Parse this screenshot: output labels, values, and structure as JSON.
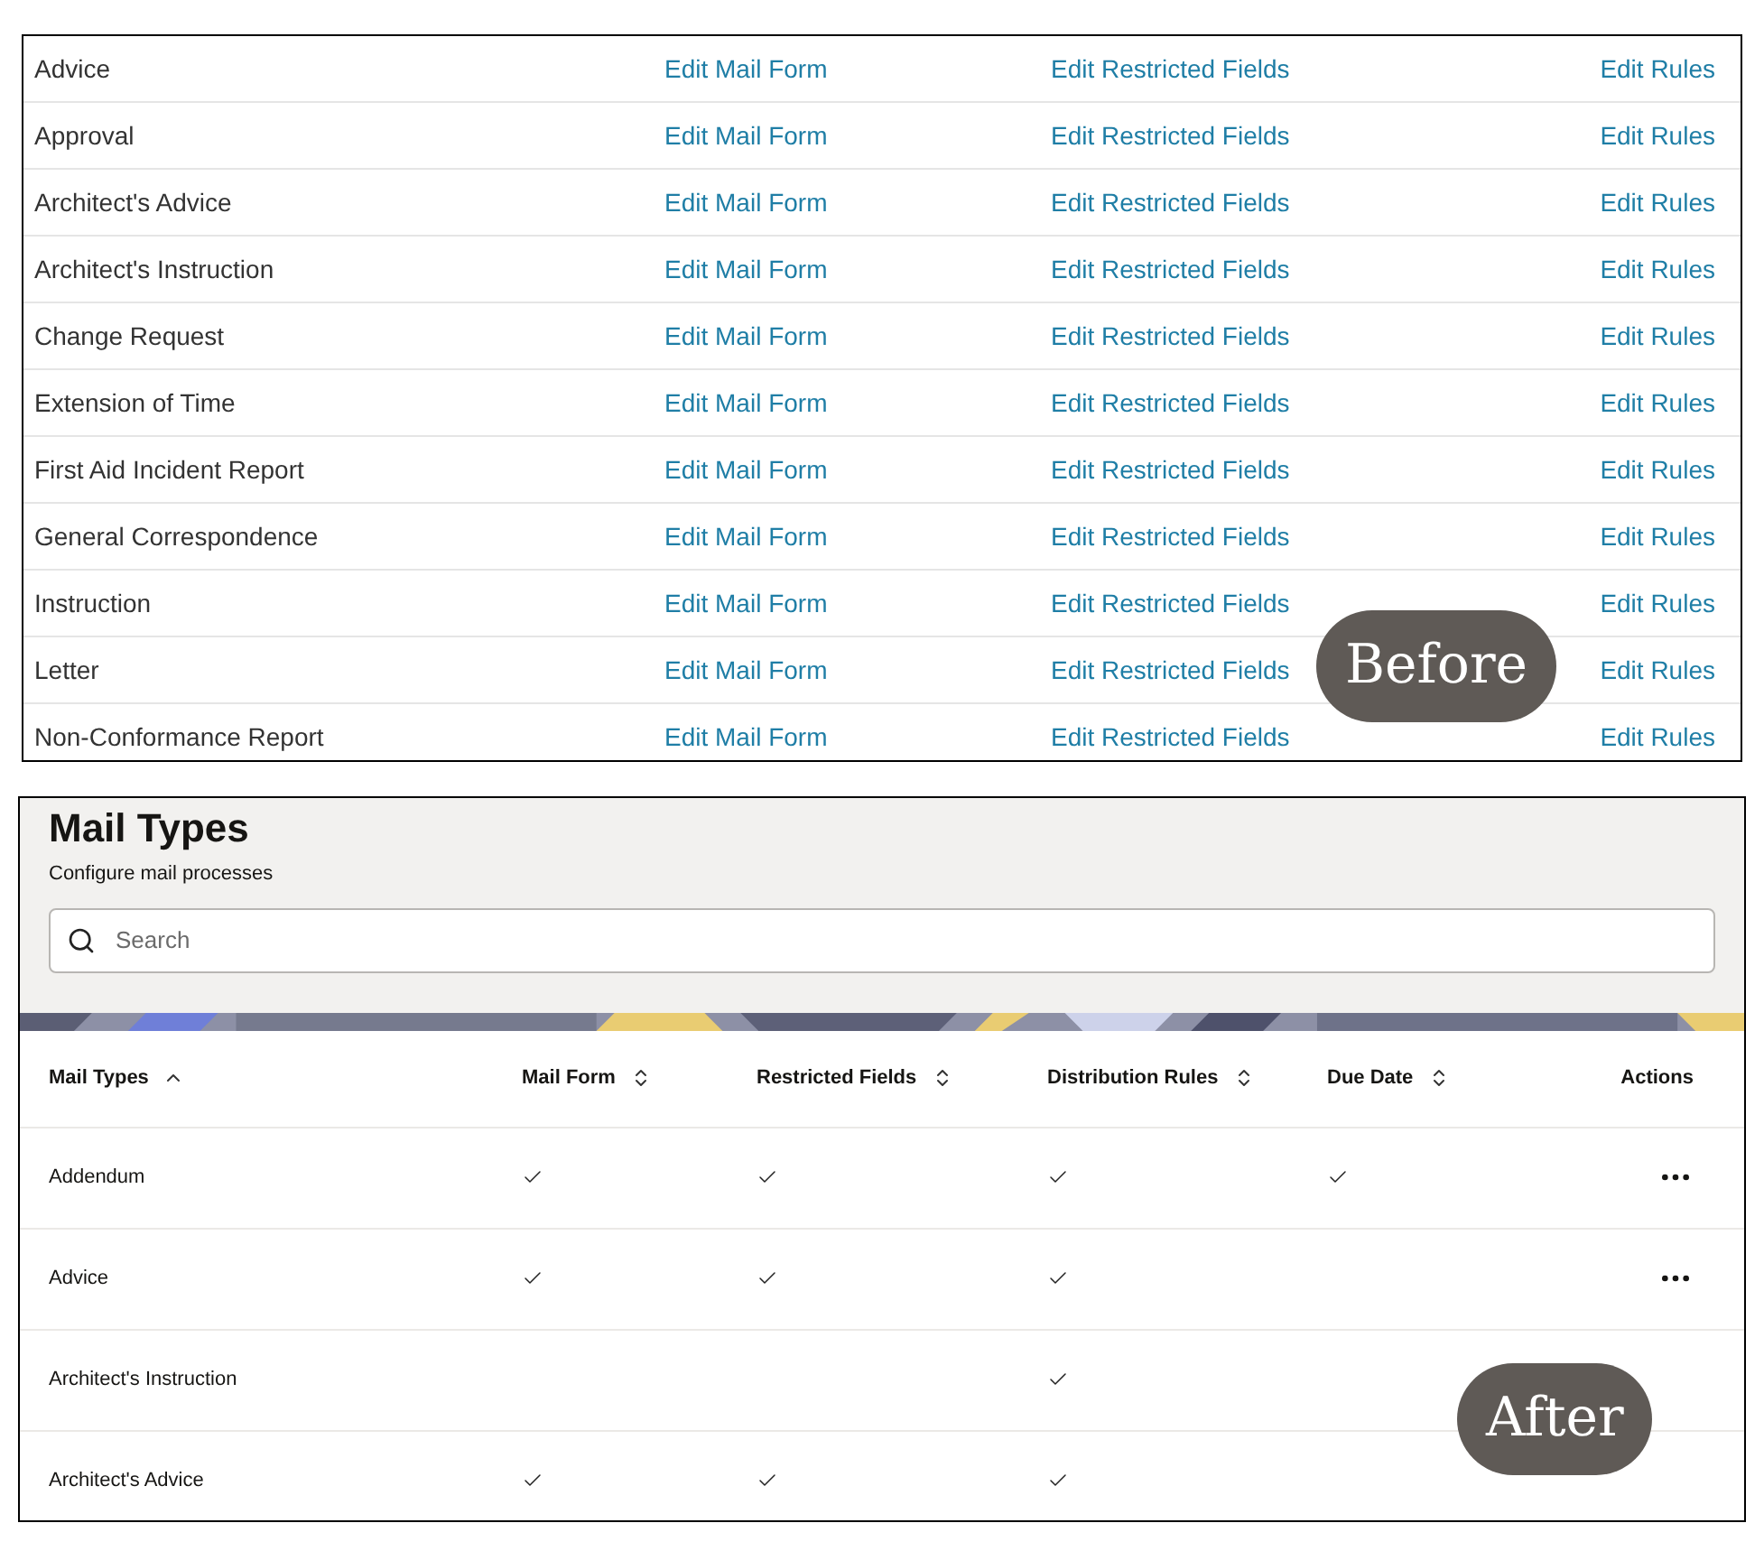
{
  "before": {
    "badge": "Before",
    "rows": [
      {
        "name": "Advice",
        "mail_form": "Edit Mail Form",
        "restricted_fields": "Edit Restricted Fields",
        "rules": "Edit Rules"
      },
      {
        "name": "Approval",
        "mail_form": "Edit Mail Form",
        "restricted_fields": "Edit Restricted Fields",
        "rules": "Edit Rules"
      },
      {
        "name": "Architect's Advice",
        "mail_form": "Edit Mail Form",
        "restricted_fields": "Edit Restricted Fields",
        "rules": "Edit Rules"
      },
      {
        "name": "Architect's Instruction",
        "mail_form": "Edit Mail Form",
        "restricted_fields": "Edit Restricted Fields",
        "rules": "Edit Rules"
      },
      {
        "name": "Change Request",
        "mail_form": "Edit Mail Form",
        "restricted_fields": "Edit Restricted Fields",
        "rules": "Edit Rules"
      },
      {
        "name": "Extension of Time",
        "mail_form": "Edit Mail Form",
        "restricted_fields": "Edit Restricted Fields",
        "rules": "Edit Rules"
      },
      {
        "name": "First Aid Incident Report",
        "mail_form": "Edit Mail Form",
        "restricted_fields": "Edit Restricted Fields",
        "rules": "Edit Rules"
      },
      {
        "name": "General Correspondence",
        "mail_form": "Edit Mail Form",
        "restricted_fields": "Edit Restricted Fields",
        "rules": "Edit Rules"
      },
      {
        "name": "Instruction",
        "mail_form": "Edit Mail Form",
        "restricted_fields": "Edit Restricted Fields",
        "rules": "Edit Rules"
      },
      {
        "name": "Letter",
        "mail_form": "Edit Mail Form",
        "restricted_fields": "Edit Restricted Fields",
        "rules": "Edit Rules"
      },
      {
        "name": "Non-Conformance Report",
        "mail_form": "Edit Mail Form",
        "restricted_fields": "Edit Restricted Fields",
        "rules": "Edit Rules"
      }
    ]
  },
  "after": {
    "badge": "After",
    "title": "Mail Types",
    "subtitle": "Configure mail processes",
    "search": {
      "placeholder": "Search"
    },
    "columns": [
      {
        "label": "Mail Types",
        "sortable": true,
        "sorted": true
      },
      {
        "label": "Mail Form",
        "sortable": true,
        "sorted": false
      },
      {
        "label": "Restricted Fields",
        "sortable": true,
        "sorted": false
      },
      {
        "label": "Distribution Rules",
        "sortable": true,
        "sorted": false
      },
      {
        "label": "Due Date",
        "sortable": true,
        "sorted": false
      },
      {
        "label": "Actions",
        "sortable": false,
        "sorted": false
      }
    ],
    "rows": [
      {
        "name": "Addendum",
        "mail_form": true,
        "restricted_fields": true,
        "distribution_rules": true,
        "due_date": true,
        "actions": true
      },
      {
        "name": "Advice",
        "mail_form": true,
        "restricted_fields": true,
        "distribution_rules": true,
        "due_date": false,
        "actions": true
      },
      {
        "name": "Architect's Instruction",
        "mail_form": false,
        "restricted_fields": false,
        "distribution_rules": true,
        "due_date": false,
        "actions": false
      },
      {
        "name": "Architect's Advice",
        "mail_form": true,
        "restricted_fields": true,
        "distribution_rules": true,
        "due_date": false,
        "actions": false
      }
    ]
  }
}
